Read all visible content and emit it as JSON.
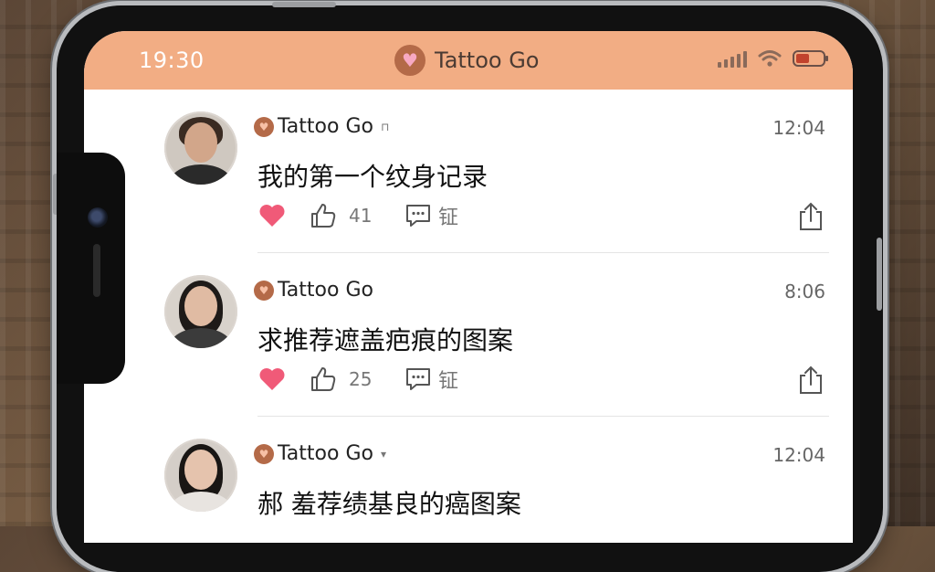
{
  "status_bar": {
    "time": "19:30",
    "app_title": "Tattoo Go"
  },
  "posts": [
    {
      "author": "Tattoo Go",
      "author_suffix": "⊓",
      "time": "12:04",
      "text": "我的第一个纹身记录",
      "likes": "41",
      "comment_label": "钲"
    },
    {
      "author": "Tattoo Go",
      "author_suffix": "",
      "time": "8:06",
      "text": "求推荐遮盖疤痕的图案",
      "likes": "25",
      "comment_label": "钲"
    },
    {
      "author": "Tattoo Go",
      "author_suffix": "▾",
      "time": "12:04",
      "text": "郝 羞荐绩基良的癌图案",
      "likes": "",
      "comment_label": ""
    }
  ],
  "colors": {
    "header": "#f2ad84",
    "heart": "#f05a78",
    "accent": "#b46a48"
  },
  "icons": [
    "heart-icon",
    "thumbs-up-icon",
    "comment-icon",
    "share-icon",
    "wifi-icon",
    "signal-icon",
    "battery-icon"
  ]
}
